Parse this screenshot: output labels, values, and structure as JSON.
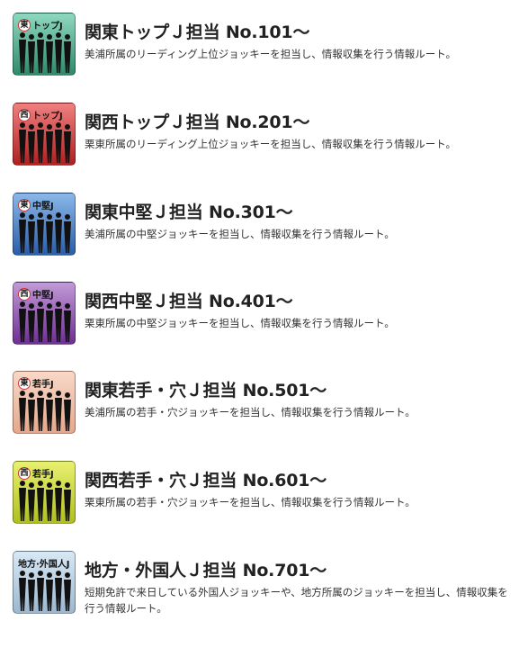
{
  "items": [
    {
      "badge_circle": "東",
      "badge_text": "トップJ",
      "title": "関東トップＪ担当 No.101～",
      "desc": "美浦所属のリーディング上位ジョッキーを担当し、情報収集を行う情報ルート。",
      "color_top": "#8fd8c0",
      "color_bottom": "#2f8a6a"
    },
    {
      "badge_circle": "西",
      "badge_text": "トップJ",
      "title": "関西トップＪ担当 No.201～",
      "desc": "栗東所属のリーディング上位ジョッキーを担当し、情報収集を行う情報ルート。",
      "color_top": "#f08080",
      "color_bottom": "#b02020"
    },
    {
      "badge_circle": "東",
      "badge_text": "中堅J",
      "title": "関東中堅Ｊ担当 No.301～",
      "desc": "美浦所属の中堅ジョッキーを担当し、情報収集を行う情報ルート。",
      "color_top": "#8ab8ea",
      "color_bottom": "#2a5ea8"
    },
    {
      "badge_circle": "西",
      "badge_text": "中堅J",
      "title": "関西中堅Ｊ担当 No.401～",
      "desc": "栗東所属の中堅ジョッキーを担当し、情報収集を行う情報ルート。",
      "color_top": "#c29ad8",
      "color_bottom": "#6e2f94"
    },
    {
      "badge_circle": "東",
      "badge_text": "若手J",
      "title": "関東若手・穴Ｊ担当 No.501～",
      "desc": "美浦所属の若手・穴ジョッキーを担当し、情報収集を行う情報ルート。",
      "color_top": "#f8d8c8",
      "color_bottom": "#e6a88c"
    },
    {
      "badge_circle": "西",
      "badge_text": "若手J",
      "title": "関西若手・穴Ｊ担当 No.601～",
      "desc": "栗東所属の若手・穴ジョッキーを担当し、情報収集を行う情報ルート。",
      "color_top": "#e8f070",
      "color_bottom": "#b0c020"
    },
    {
      "badge_circle": "",
      "badge_text": "地方·外国人J",
      "title": "地方・外国人Ｊ担当 No.701～",
      "desc": "短期免許で来日している外国人ジョッキーや、地方所属のジョッキーを担当し、情報収集を行う情報ルート。",
      "color_top": "#d8e8f4",
      "color_bottom": "#9cb8d0"
    }
  ]
}
